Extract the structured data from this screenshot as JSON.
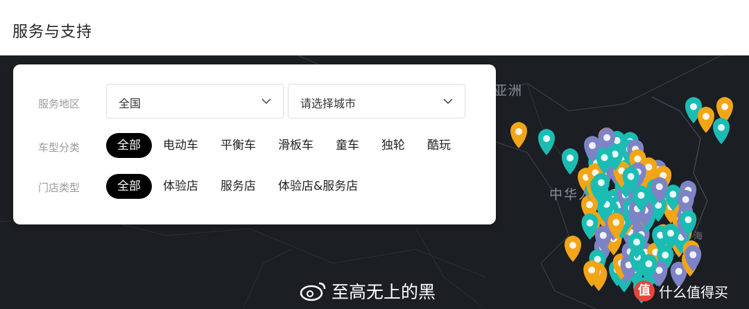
{
  "page": {
    "title": "服务与支持"
  },
  "map": {
    "labels": {
      "asia": "亚洲",
      "china": "中华人",
      "sea": "海"
    },
    "colors": {
      "background": "#1b1e23",
      "experience": "#f2a516",
      "service": "#1bbcb4",
      "both": "#7e83c6"
    }
  },
  "filters": {
    "region": {
      "label": "服务地区",
      "province": "全国",
      "city_placeholder": "请选择城市"
    },
    "vehicle": {
      "label": "车型分类",
      "options": [
        "全部",
        "电动车",
        "平衡车",
        "滑板车",
        "童车",
        "独轮",
        "酷玩"
      ],
      "selected": "全部"
    },
    "store": {
      "label": "门店类型",
      "options": [
        "全部",
        "体验店",
        "服务店",
        "体验店&服务店"
      ],
      "selected": "全部"
    }
  },
  "watermarks": {
    "weibo": "至高无上的黑",
    "smzdm": "什么值得买",
    "smzdm_badge": "值"
  }
}
